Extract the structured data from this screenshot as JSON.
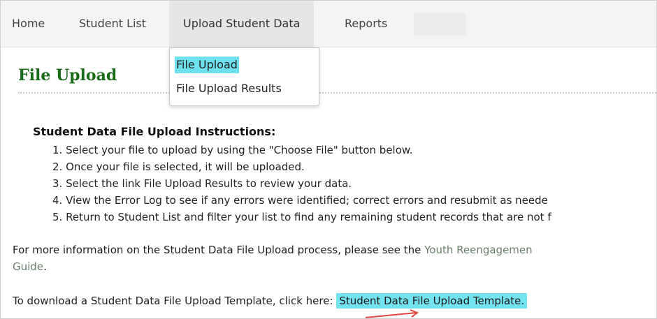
{
  "nav": {
    "home": "Home",
    "student_list": "Student List",
    "upload_student_data": "Upload Student Data",
    "reports": "Reports"
  },
  "dropdown": {
    "items": [
      {
        "label": "File Upload"
      },
      {
        "label": "File Upload Results"
      }
    ]
  },
  "page": {
    "title": "File Upload"
  },
  "instructions": {
    "heading": "Student Data File Upload Instructions:",
    "steps": [
      "1. Select your file to upload by using the \"Choose File\" button below.",
      "2. Once your file is selected, it will be uploaded.",
      "3. Select the link File Upload Results to review your data.",
      "4. View the Error Log to see if any errors were identified; correct errors and resubmit as neede",
      "5. Return to Student List and filter your list to find any remaining student records that are not f"
    ]
  },
  "info": {
    "text": "For more information on the Student Data File Upload process, please see the ",
    "link": "Youth Reengagemen",
    "link_cont": "Guide",
    "tail": "."
  },
  "download": {
    "text": "To download a Student Data File Upload Template, click here: ",
    "link": "Student Data File Upload Template."
  },
  "colors": {
    "title": "#1a6b1a",
    "highlight": "#74e3f0",
    "arrow": "#e0463f"
  }
}
